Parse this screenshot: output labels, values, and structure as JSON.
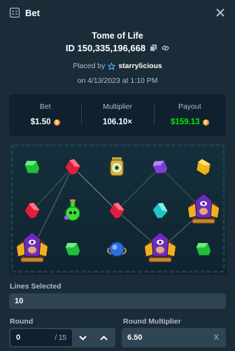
{
  "window": {
    "title": "Bet",
    "close_icon": "close-icon",
    "bet_icon": "slot-icon"
  },
  "bet": {
    "game_title": "Tome of Life",
    "id_text": "ID 150,335,196,668",
    "placed_prefix": "Placed by",
    "username": "starrylicious",
    "date_text": "on 4/13/2023 at 1:10 PM"
  },
  "stats": {
    "bet_label": "Bet",
    "bet_value": "$1.50",
    "multiplier_label": "Multiplier",
    "multiplier_value": "106.10×",
    "payout_label": "Payout",
    "payout_value": "$159.13",
    "currency_icon": "bitcoin-icon",
    "payout_color": "#00e701"
  },
  "board": {
    "rows": [
      [
        "green-gem",
        "red-gem",
        "eye-lantern",
        "purple-gem",
        "yellow-gem"
      ],
      [
        "red-gem",
        "green-potion",
        "red-gem",
        "cyan-gem",
        "wizard-scarab"
      ],
      [
        "wizard-scarab",
        "green-gem",
        "blue-orb",
        "wizard-scarab",
        "green-gem"
      ]
    ]
  },
  "controls": {
    "lines_label": "Lines Selected",
    "lines_value": "10",
    "round_label": "Round",
    "round_value": "0",
    "round_total": "/ 15",
    "round_multiplier_label": "Round Multiplier",
    "round_multiplier_value": "6.50",
    "round_multiplier_suffix": "X"
  },
  "colors": {
    "background": "#1a2c38",
    "panel": "#0f212e",
    "field": "#2f4553",
    "muted_text": "#b1bad3"
  }
}
